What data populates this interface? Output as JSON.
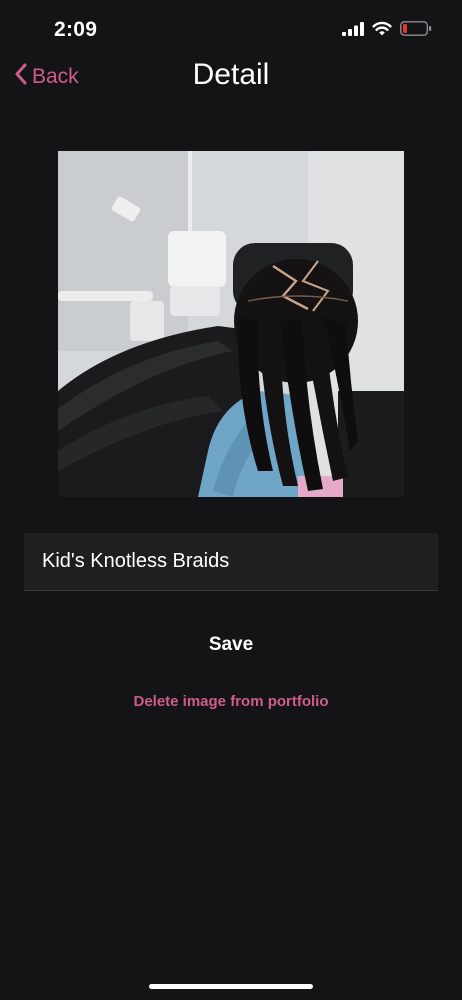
{
  "status_bar": {
    "time": "2:09",
    "icons": [
      "cellular-signal-icon",
      "wifi-icon",
      "battery-low-icon"
    ],
    "battery_color": "#e5352b"
  },
  "nav": {
    "back_label": "Back",
    "title": "Detail"
  },
  "image": {
    "icon": "portfolio-photo"
  },
  "form": {
    "title_value": "Kid's Knotless Braids"
  },
  "actions": {
    "save_label": "Save",
    "delete_label": "Delete image from portfolio"
  },
  "colors": {
    "background": "#141416",
    "accent": "#cf5c8e",
    "field_bg": "#1f1f22"
  }
}
